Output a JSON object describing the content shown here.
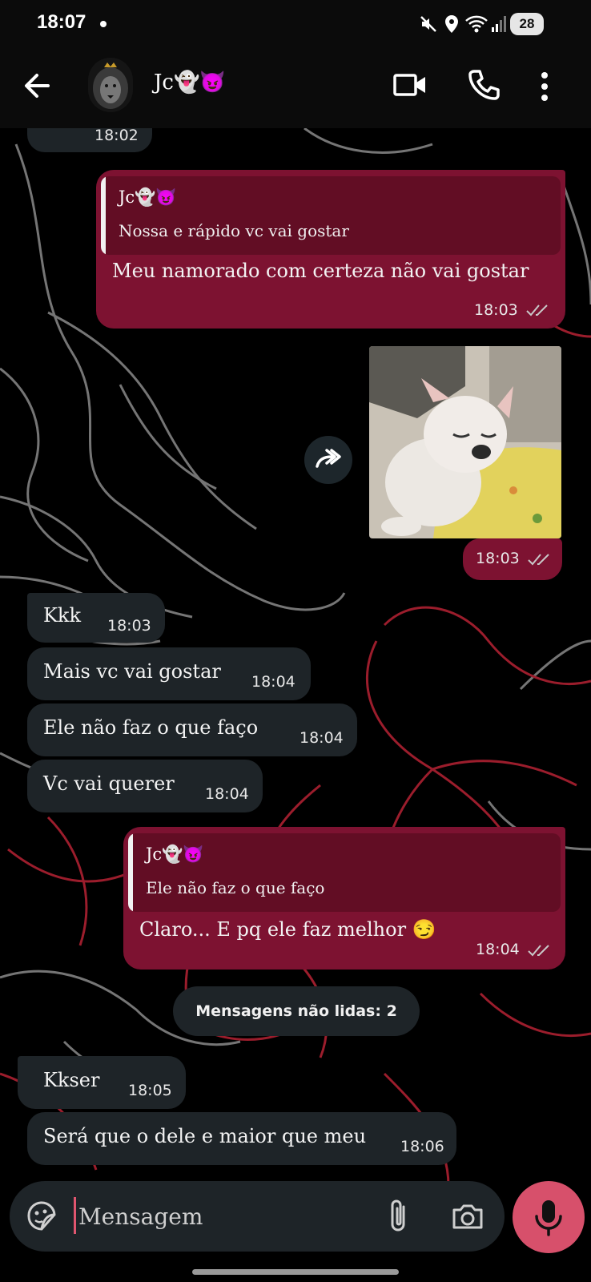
{
  "status_bar": {
    "time": "18:07",
    "battery": "28"
  },
  "header": {
    "contact_name": "Jc👻😈"
  },
  "messages": {
    "partial_time": "18:02",
    "out1": {
      "quote_author": "Jc👻😈",
      "quote_text": "Nossa e rápido vc vai gostar",
      "text": "Meu namorado com certeza não vai gostar",
      "time": "18:03"
    },
    "out_image": {
      "time": "18:03"
    },
    "in1": {
      "text": "Kkk",
      "time": "18:03"
    },
    "in2": {
      "text": "Mais vc vai gostar",
      "time": "18:04"
    },
    "in3": {
      "text": "Ele não faz o que faço",
      "time": "18:04"
    },
    "in4": {
      "text": "Vc vai querer",
      "time": "18:04"
    },
    "out2": {
      "quote_author": "Jc👻😈",
      "quote_text": "Ele não faz o que faço",
      "text": "Claro... E pq ele faz melhor 😏",
      "time": "18:04"
    },
    "unread_divider": "Mensagens não lidas: 2",
    "in5": {
      "text": "Kkser",
      "time": "18:05"
    },
    "in6": {
      "text": "Será que o dele e maior que meu",
      "time": "18:06"
    }
  },
  "composer": {
    "placeholder": "Mensagem"
  },
  "colors": {
    "outgoing_bubble": "#7d1231",
    "incoming_bubble": "#1e2428",
    "mic_button": "#d7506b"
  }
}
